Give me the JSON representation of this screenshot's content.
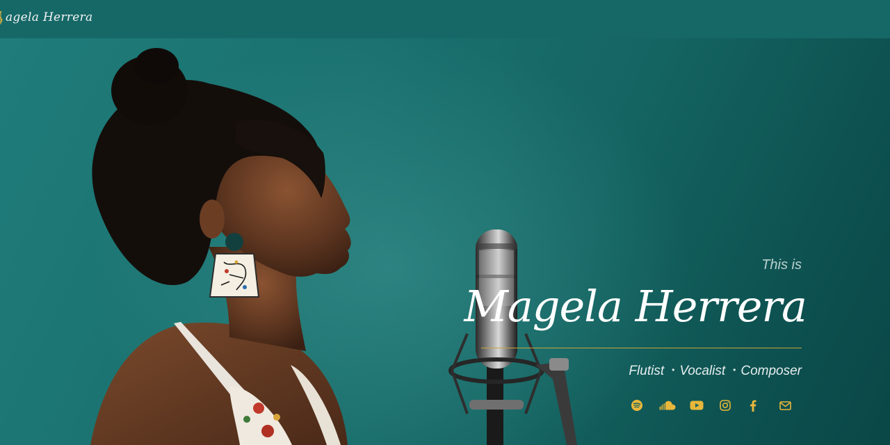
{
  "header": {
    "logo_text": "agela Herrera",
    "logo_icon": "treble-clef-icon"
  },
  "hero": {
    "intro": "This is",
    "name": "Magela Herrera",
    "roles": [
      "Flutist",
      "Vocalist",
      "Composer"
    ],
    "role_separator": "•"
  },
  "social": [
    {
      "name": "spotify",
      "icon": "spotify-icon"
    },
    {
      "name": "soundcloud",
      "icon": "soundcloud-icon"
    },
    {
      "name": "youtube",
      "icon": "youtube-icon"
    },
    {
      "name": "instagram",
      "icon": "instagram-icon"
    },
    {
      "name": "facebook",
      "icon": "facebook-icon"
    },
    {
      "name": "email",
      "icon": "envelope-icon"
    }
  ],
  "colors": {
    "topbar": "#166867",
    "hero_background": "#1a716f",
    "accent_gold": "#e8b73a",
    "divider": "#c9a53a",
    "text": "#ffffff"
  }
}
